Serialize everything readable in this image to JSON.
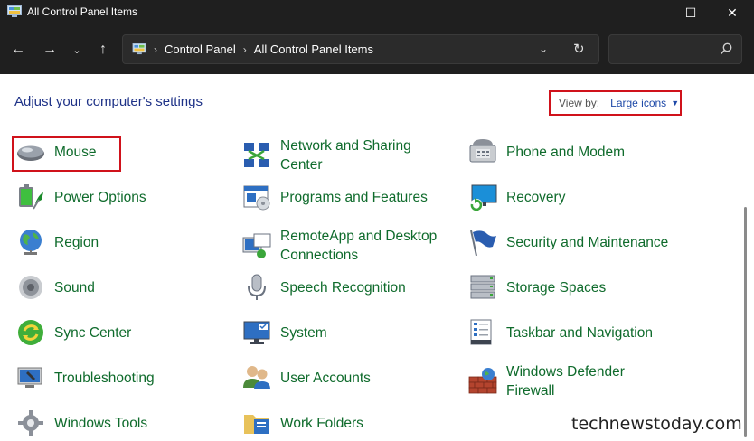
{
  "window": {
    "title": "All Control Panel Items",
    "controls": {
      "minimize": "—",
      "maximize": "☐",
      "close": "✕"
    }
  },
  "navigation": {
    "back": "←",
    "forward": "→",
    "recent": "⌄",
    "up": "↑",
    "breadcrumb": [
      "Control Panel",
      "All Control Panel Items"
    ],
    "breadcrumb_separator": "›",
    "dropdown": "⌄",
    "refresh": "↻",
    "search_placeholder": ""
  },
  "content": {
    "heading": "Adjust your computer's settings",
    "view_by": {
      "label": "View by:",
      "value": "Large icons"
    }
  },
  "items": [
    {
      "label": "Mouse",
      "icon": "mouse-icon"
    },
    {
      "label": "Network and Sharing Center",
      "icon": "network-icon"
    },
    {
      "label": "Phone and Modem",
      "icon": "phone-icon"
    },
    {
      "label": "Power Options",
      "icon": "power-icon"
    },
    {
      "label": "Programs and Features",
      "icon": "programs-icon"
    },
    {
      "label": "Recovery",
      "icon": "recovery-icon"
    },
    {
      "label": "Region",
      "icon": "globe-icon"
    },
    {
      "label": "RemoteApp and Desktop Connections",
      "icon": "remoteapp-icon"
    },
    {
      "label": "Security and Maintenance",
      "icon": "flag-icon"
    },
    {
      "label": "Sound",
      "icon": "speaker-icon"
    },
    {
      "label": "Speech Recognition",
      "icon": "microphone-icon"
    },
    {
      "label": "Storage Spaces",
      "icon": "storage-icon"
    },
    {
      "label": "Sync Center",
      "icon": "sync-icon"
    },
    {
      "label": "System",
      "icon": "monitor-icon"
    },
    {
      "label": "Taskbar and Navigation",
      "icon": "taskbar-icon"
    },
    {
      "label": "Troubleshooting",
      "icon": "troubleshoot-icon"
    },
    {
      "label": "User Accounts",
      "icon": "users-icon"
    },
    {
      "label": "Windows Defender Firewall",
      "icon": "firewall-icon"
    },
    {
      "label": "Windows Tools",
      "icon": "gear-icon"
    },
    {
      "label": "Work Folders",
      "icon": "folder-icon"
    }
  ],
  "watermark": "technewstoday.com",
  "colors": {
    "titlebar": "#1f1f1f",
    "link_green": "#0f6b2c",
    "heading_blue": "#1e3287",
    "highlight_red": "#d0121b"
  }
}
